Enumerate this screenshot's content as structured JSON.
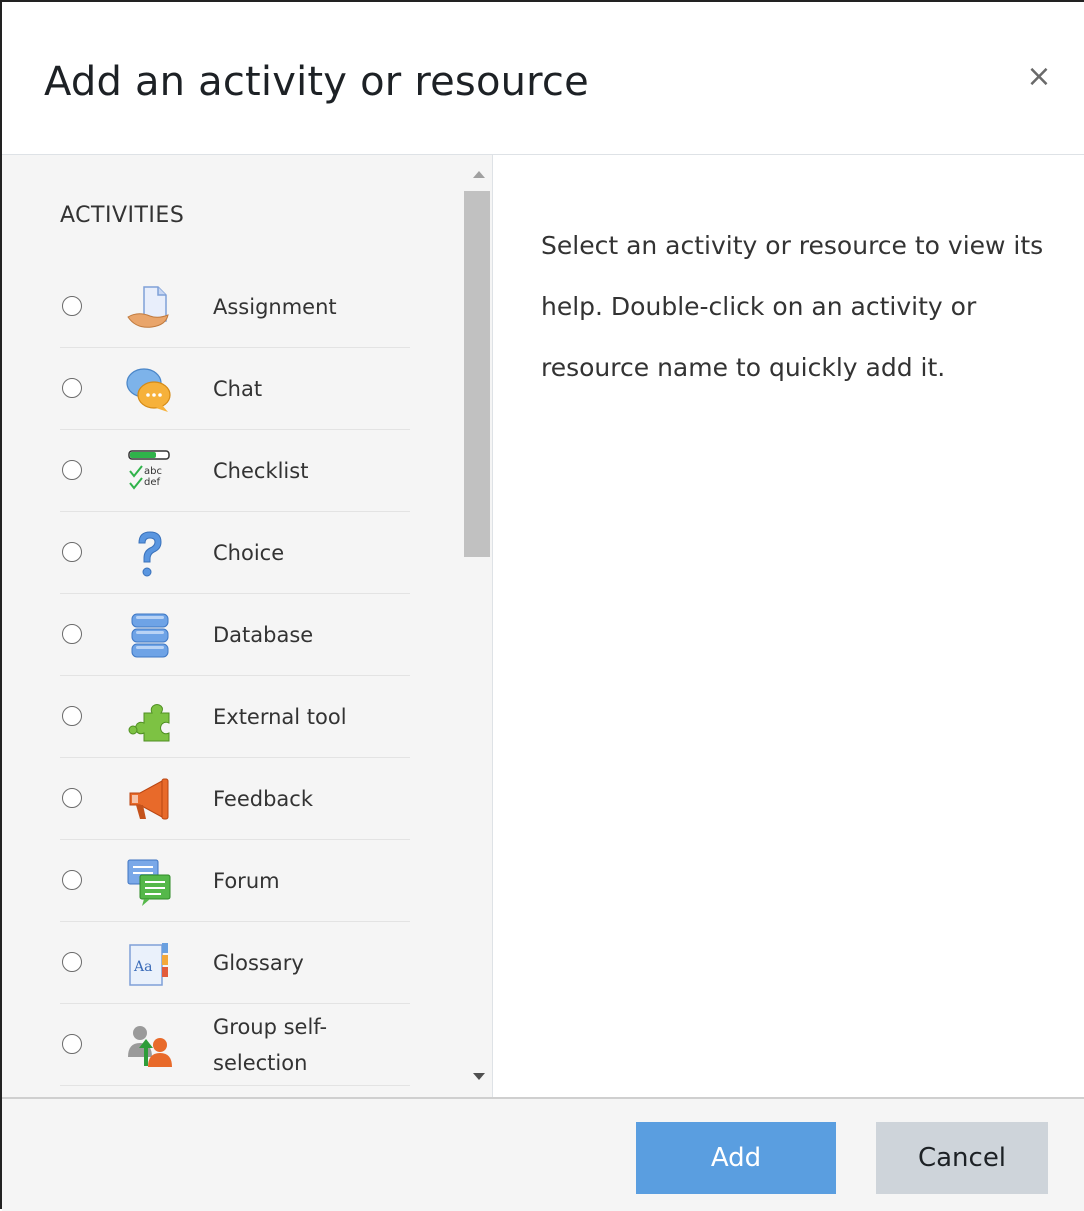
{
  "dialog": {
    "title": "Add an activity or resource",
    "close_glyph": "×"
  },
  "activities": {
    "heading": "ACTIVITIES",
    "items": [
      {
        "label": "Assignment",
        "icon": "assignment-icon"
      },
      {
        "label": "Chat",
        "icon": "chat-icon"
      },
      {
        "label": "Checklist",
        "icon": "checklist-icon"
      },
      {
        "label": "Choice",
        "icon": "choice-icon"
      },
      {
        "label": "Database",
        "icon": "database-icon"
      },
      {
        "label": "External tool",
        "icon": "external-tool-icon"
      },
      {
        "label": "Feedback",
        "icon": "feedback-icon"
      },
      {
        "label": "Forum",
        "icon": "forum-icon"
      },
      {
        "label": "Glossary",
        "icon": "glossary-icon"
      },
      {
        "label": "Group self-selection",
        "icon": "group-self-selection-icon"
      }
    ],
    "checklist_icon_text": {
      "line1": "abc",
      "line2": "def"
    },
    "glossary_icon_text": "Aa"
  },
  "help": {
    "text": "Select an activity or resource to view its help. Double-click on an activity or resource name to quickly add it."
  },
  "footer": {
    "add_label": "Add",
    "cancel_label": "Cancel"
  },
  "colors": {
    "primary": "#5a9ee0",
    "secondary": "#ced4da",
    "pane_bg": "#f5f5f5"
  }
}
